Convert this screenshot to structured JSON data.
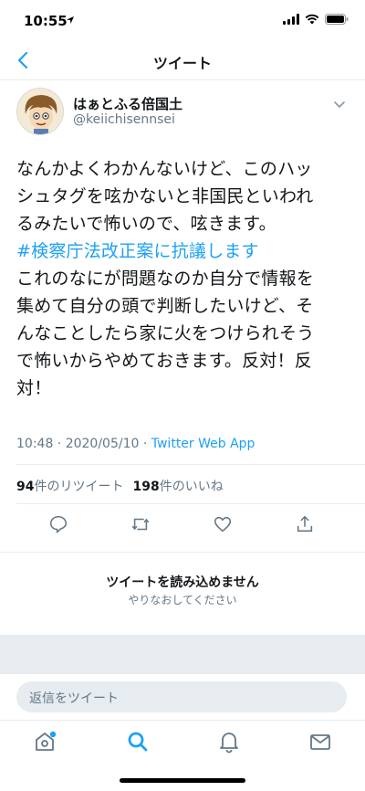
{
  "status_bar": {
    "time": "10:55"
  },
  "nav": {
    "title": "ツイート"
  },
  "tweet": {
    "author_name": "はぁとふる倍国土",
    "author_handle": "@keiichisennsei",
    "lines": [
      "なんかよくわかんないけど、このハッ",
      "シュタグを呟かないと非国民といわれ",
      "るみたいで怖いので、呟きます。"
    ],
    "hashtag": "#検察庁法改正案に抗議します",
    "lines_after": [
      "これのなにが問題なのか自分で情報を",
      "集めて自分の頭で判断したいけど、そ",
      "んなことしたら家に火をつけられそう",
      "で怖いからやめておきます。反対！反",
      "対！"
    ],
    "time": "10:48 · 2020/05/10 · ",
    "source": "Twitter Web App",
    "retweets_count": "94",
    "retweets_label": "件のリツイート",
    "likes_count": "198",
    "likes_label": "件のいいね"
  },
  "error": {
    "title": "ツイートを読み込めません",
    "subtitle": "やりなおしてください"
  },
  "reply": {
    "placeholder": "返信をツイート"
  },
  "colors": {
    "accent": "#1da1f2",
    "secondary_text": "#657786",
    "divider": "#e6ecf0"
  },
  "icons": {
    "actions": [
      "reply-icon",
      "retweet-icon",
      "like-icon",
      "share-icon"
    ],
    "tabs": [
      "home-icon",
      "search-icon",
      "notifications-icon",
      "messages-icon"
    ]
  }
}
